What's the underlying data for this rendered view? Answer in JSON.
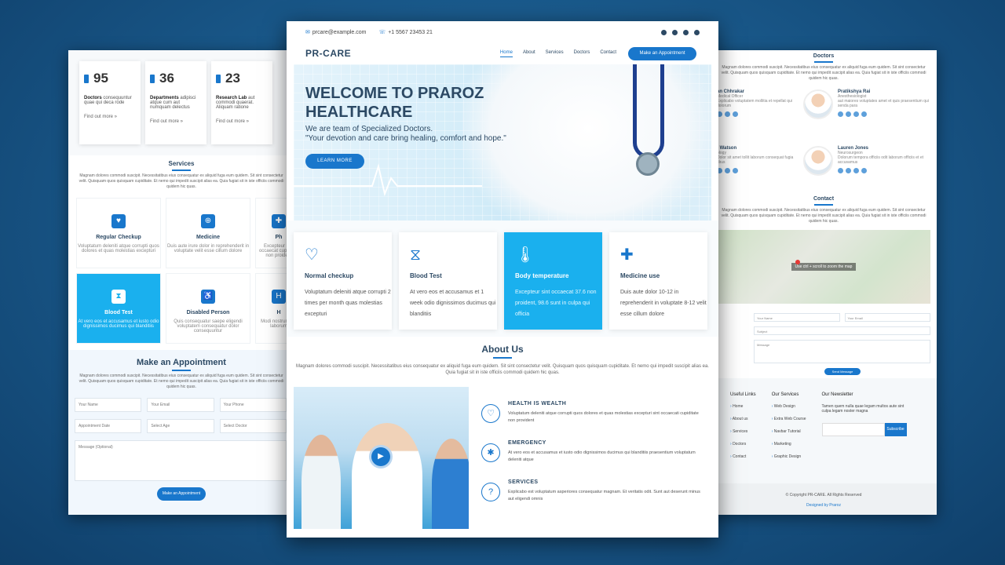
{
  "left": {
    "stats": [
      {
        "num": "95",
        "label": "Doctors",
        "desc": "consequuntur quae qui deca rode",
        "more": "Find out more »"
      },
      {
        "num": "36",
        "label": "Departments",
        "desc": "adipisci atque cum aut numquam delectus",
        "more": "Find out more »"
      },
      {
        "num": "23",
        "label": "Research Lab",
        "desc": "aut commodi quaerat. Aliquam ratione",
        "more": "Find out more »"
      }
    ],
    "services_title": "Services",
    "services_desc": "Magnam dolores commodi suscipit. Necessitatibus eius consequatur ex aliquid fuga eum quidem. Sit sint consectetur velit. Quisquam quos quisquam cupiditate. Et nemo qui impedit suscipit alias ea. Quia fugiat sit in iste officiis commodi quidem hic quas.",
    "services": [
      {
        "title": "Regular Checkup",
        "desc": "Voluptatum deleniti atque corrupti quos dolores et quas molestias excepturi",
        "icon": "heart-icon",
        "glyph": "♥"
      },
      {
        "title": "Medicine",
        "desc": "Duis aute irure dolor in reprehenderit in voluptate velit esse cillum dolore",
        "icon": "pills-icon",
        "glyph": "⊕"
      },
      {
        "title": "Ph",
        "desc": "Excepteur sint occaecat cupidatat non proident",
        "icon": "pharmacy-icon",
        "glyph": "✚"
      },
      {
        "title": "Blood Test",
        "desc": "At vero eos et accusamus et iusto odio dignissimos ducimus qui blanditiis",
        "icon": "hourglass-icon",
        "glyph": "⧗"
      },
      {
        "title": "Disabled Person",
        "desc": "Quis consequatur saepe eligendi voluptatem consequatur dolor consequuntur",
        "icon": "wheelchair-icon",
        "glyph": "♿"
      },
      {
        "title": "H",
        "desc": "Modi nostrum vel laborum",
        "icon": "hospital-icon",
        "glyph": "H"
      }
    ],
    "appointment_title": "Make an Appointment",
    "appointment_desc": "Magnam dolores commodi suscipit. Necessitatibus eius consequatur ex aliquid fuga eum quidem. Sit sint consectetur velit. Quisquam quos quisquam cupiditate. Et nemo qui impedit suscipit alias ea. Quia fugiat sit in iste officiis commodi quidem hic quas.",
    "form": {
      "name": "Your Name",
      "email": "Your Email",
      "phone": "Your Phone",
      "date": "Appointment Date",
      "age": "Select Age",
      "doctor": "Select Doctor",
      "message": "Message (Optional)"
    },
    "appointment_button": "Make an Appointment"
  },
  "right": {
    "doctors_title": "Doctors",
    "doctors_desc": "Magnam dolores commodi suscipit. Necessitatibus eius consequatur ex aliquid fuga eum quidem. Sit sint consectetur velit. Quisquam quos quisquam cupiditate. Et nemo qui impedit suscipit alias ea. Quia fugiat sit in iste officiis commodi quidem hic quas.",
    "doctors": [
      {
        "name": "an Chhrakar",
        "role": "Medical Officer",
        "desc": "Explicabo voluptatem mollitia et repellat qui dolorum"
      },
      {
        "name": "Pratikshya Rai",
        "role": "Anesthesiologist",
        "desc": "aut maiores voluptates amet et quis praesentium qui senda para"
      },
      {
        "name": "t Watson",
        "role": "ology",
        "desc": "Dolor sit amet tollit laborum consequat fugia tibus"
      },
      {
        "name": "Lauren Jones",
        "role": "Neurosurgeon",
        "desc": "Dolorum tempora officiis odit laborum officiis et et accusamus"
      }
    ],
    "contact_title": "Contact",
    "contact_desc": "Magnam dolores commodi suscipit. Necessitatibus eius consequatur ex aliquid fuga eum quidem. Sit sint consectetur velit. Quisquam quos quisquam cupiditate. Et nemo qui impedit suscipit alias ea. Quia fugiat sit in iste officiis commodi quidem hic quas.",
    "map_overlay": "Use ctrl + scroll to zoom the map",
    "form": {
      "name": "Your Name",
      "email": "Your Email",
      "subject": "Subject",
      "message": "Message"
    },
    "send_button": "Send Message",
    "useful_title": "Useful Links",
    "useful_links": [
      "Home",
      "About us",
      "Services",
      "Doctors",
      "Contact"
    ],
    "services_title": "Our Services",
    "services_links": [
      "Web Design",
      "Extra Web Course",
      "Navbar Tutorial",
      "Marketing",
      "Graphic Design"
    ],
    "newsletter_title": "Our Newsletter",
    "newsletter_desc": "Tamen quem nulla quae legam multos aute sint culpa legam noster magna",
    "subscribe": "Subscribe",
    "copyright": "© Copyright PR-CARE. All Rights Reserved",
    "designed": "Designed by Praroz"
  },
  "main": {
    "email": "prcare@example.com",
    "phone": "+1 5567 23453 21",
    "logo": "PR-CARE",
    "menu": [
      "Home",
      "About",
      "Services",
      "Doctors",
      "Contact"
    ],
    "nav_button": "Make an Appointment",
    "hero_title": "WELCOME TO PRAROZ HEALTHCARE",
    "hero_sub1": "We are team of Specialized Doctors.",
    "hero_sub2": "\"Your devotion and care bring healing, comfort and hope.\"",
    "learn_more": "LEARN MORE",
    "features": [
      {
        "title": "Normal checkup",
        "desc": "Voluptatum deleniti atque corrupti 2 times per month quas molestias excepturi",
        "icon": "heartbeat-icon",
        "glyph": "♡"
      },
      {
        "title": "Blood Test",
        "desc": "At vero eos et accusamus et 1 week odio dignissimos ducimus qui blanditiis",
        "icon": "dna-icon",
        "glyph": "⧖"
      },
      {
        "title": "Body temperature",
        "desc": "Excepteur sint occaecat 37.6 non proident, 98.6 sunt in culpa qui officia",
        "icon": "thermometer-icon",
        "glyph": "🌡"
      },
      {
        "title": "Medicine use",
        "desc": "Duis aute dolor 10-12 in reprehenderit in voluptate 8-12 velit esse cillum dolore",
        "icon": "hand-medical-icon",
        "glyph": "✚"
      }
    ],
    "about_title": "About Us",
    "about_desc": "Magnam dolores commodi suscipit. Necessitatibus eius consequatur ex aliquid fuga eum quidem. Sit sint consectetur velit. Quisquam quos quisquam cupiditate. Et nemo qui impedit suscipit alias ea. Quia fugiat sit in iste officiis commodi quidem hic quas.",
    "about_items": [
      {
        "title": "HEALTH IS WEALTH",
        "desc": "Voluptatum deleniti atque corrupti quos dolores et quas molestias excepturi sint occaecati cupiditate non provident",
        "icon": "heart-outline-icon",
        "glyph": "♡"
      },
      {
        "title": "EMERGENCY",
        "desc": "At vero eos et accusamus et iusto odio dignissimos ducimus qui blanditiis praesentium voluptatum deleniti atque",
        "icon": "asterisk-icon",
        "glyph": "✱"
      },
      {
        "title": "SERVICES",
        "desc": "Explicabo est voluptatum asperiores consequatur magnam. Et veritatis odit. Sunt aut deserunt minus aut eligendi omnis",
        "icon": "question-icon",
        "glyph": "?"
      }
    ]
  }
}
